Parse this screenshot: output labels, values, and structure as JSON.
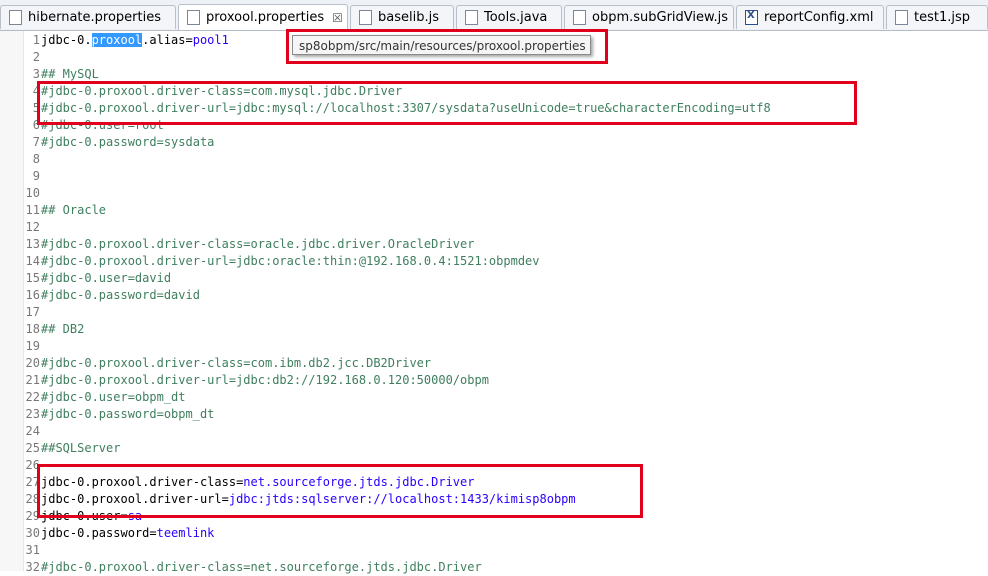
{
  "tabs": [
    {
      "label": "hibernate.properties",
      "active": false,
      "icon": "properties-file-icon"
    },
    {
      "label": "proxool.properties",
      "active": true,
      "icon": "properties-file-icon",
      "close": "☒"
    },
    {
      "label": "baselib.js",
      "active": false,
      "icon": "js-file-icon"
    },
    {
      "label": "Tools.java",
      "active": false,
      "icon": "java-file-icon"
    },
    {
      "label": "obpm.subGridView.js",
      "active": false,
      "icon": "js-file-icon"
    },
    {
      "label": "reportConfig.xml",
      "active": false,
      "icon": "xml-file-icon"
    },
    {
      "label": "test1.jsp",
      "active": false,
      "icon": "jsp-file-icon"
    }
  ],
  "tooltip": {
    "text": "sp8obpm/src/main/resources/proxool.properties"
  },
  "lines": [
    {
      "n": "1",
      "parts": [
        {
          "t": "jdbc-0.",
          "c": "key"
        },
        {
          "t": "proxool",
          "c": "sel"
        },
        {
          "t": ".alias=",
          "c": "key"
        },
        {
          "t": "pool1",
          "c": "blue"
        }
      ]
    },
    {
      "n": "2",
      "parts": []
    },
    {
      "n": "3",
      "parts": [
        {
          "t": "## MySQL",
          "c": "comment"
        }
      ]
    },
    {
      "n": "4",
      "parts": [
        {
          "t": "#jdbc-0.proxool.driver-class=com.mysql.jdbc.Driver",
          "c": "comment"
        }
      ]
    },
    {
      "n": "5",
      "parts": [
        {
          "t": "#jdbc-0.proxool.driver-url=jdbc:mysql://localhost:3307/sysdata?useUnicode=true&characterEncoding=utf8",
          "c": "comment"
        }
      ]
    },
    {
      "n": "6",
      "parts": [
        {
          "t": "#jdbc-0.user=root",
          "c": "comment"
        }
      ]
    },
    {
      "n": "7",
      "parts": [
        {
          "t": "#jdbc-0.password=sysdata",
          "c": "comment"
        }
      ]
    },
    {
      "n": "8",
      "parts": []
    },
    {
      "n": "9",
      "parts": []
    },
    {
      "n": "10",
      "parts": []
    },
    {
      "n": "11",
      "parts": [
        {
          "t": "## Oracle",
          "c": "comment"
        }
      ]
    },
    {
      "n": "12",
      "parts": []
    },
    {
      "n": "13",
      "parts": [
        {
          "t": "#jdbc-0.proxool.driver-class=oracle.jdbc.driver.OracleDriver",
          "c": "comment"
        }
      ]
    },
    {
      "n": "14",
      "parts": [
        {
          "t": "#jdbc-0.proxool.driver-url=jdbc:oracle:thin:@192.168.0.4:1521:obpmdev",
          "c": "comment"
        }
      ]
    },
    {
      "n": "15",
      "parts": [
        {
          "t": "#jdbc-0.user=david",
          "c": "comment"
        }
      ]
    },
    {
      "n": "16",
      "parts": [
        {
          "t": "#jdbc-0.password=david",
          "c": "comment"
        }
      ]
    },
    {
      "n": "17",
      "parts": []
    },
    {
      "n": "18",
      "parts": [
        {
          "t": "## DB2",
          "c": "comment"
        }
      ]
    },
    {
      "n": "19",
      "parts": []
    },
    {
      "n": "20",
      "parts": [
        {
          "t": "#jdbc-0.proxool.driver-class=com.ibm.db2.jcc.DB2Driver",
          "c": "comment"
        }
      ]
    },
    {
      "n": "21",
      "parts": [
        {
          "t": "#jdbc-0.proxool.driver-url=jdbc:db2://192.168.0.120:50000/obpm",
          "c": "comment"
        }
      ]
    },
    {
      "n": "22",
      "parts": [
        {
          "t": "#jdbc-0.user=obpm_dt",
          "c": "comment"
        }
      ]
    },
    {
      "n": "23",
      "parts": [
        {
          "t": "#jdbc-0.password=obpm_dt",
          "c": "comment"
        }
      ]
    },
    {
      "n": "24",
      "parts": []
    },
    {
      "n": "25",
      "parts": [
        {
          "t": "##SQLServer",
          "c": "comment"
        }
      ]
    },
    {
      "n": "26",
      "parts": []
    },
    {
      "n": "27",
      "parts": [
        {
          "t": "jdbc-0.proxool.driver-class=",
          "c": "key"
        },
        {
          "t": "net.sourceforge.jtds.jdbc.Driver",
          "c": "blue"
        }
      ]
    },
    {
      "n": "28",
      "parts": [
        {
          "t": "jdbc-0.proxool.driver-url=",
          "c": "key"
        },
        {
          "t": "jdbc:jtds:sqlserver://localhost:1433/kimisp8obpm",
          "c": "blue"
        }
      ]
    },
    {
      "n": "29",
      "parts": [
        {
          "t": "jdbc-0.user=",
          "c": "key"
        },
        {
          "t": "sa",
          "c": "blue"
        }
      ]
    },
    {
      "n": "30",
      "parts": [
        {
          "t": "jdbc-0.password=",
          "c": "key"
        },
        {
          "t": "teemlink",
          "c": "blue"
        }
      ]
    },
    {
      "n": "31",
      "parts": []
    },
    {
      "n": "32",
      "parts": [
        {
          "t": "#jdbc-0.proxool.driver-class=net.sourceforge.jtds.jdbc.Driver",
          "c": "comment"
        }
      ]
    }
  ],
  "colors": {
    "comment": "#3f7f5f",
    "value": "#2a00ff",
    "selection": "#3399ff",
    "highlight_box": "#e0001b"
  }
}
